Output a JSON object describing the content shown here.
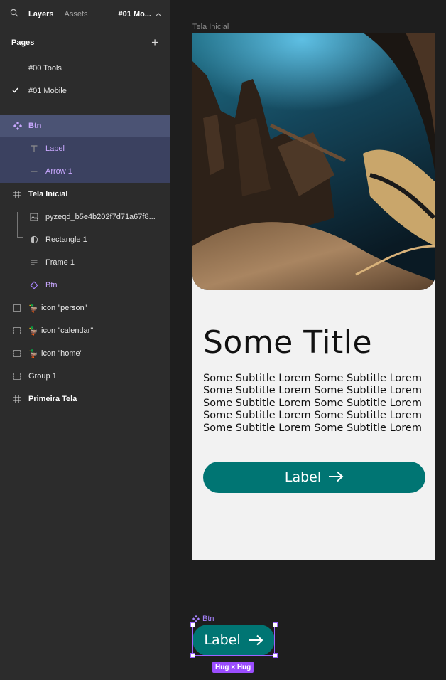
{
  "topbar": {
    "tabs": [
      "Layers",
      "Assets"
    ],
    "page_selector": "#01 Mo...",
    "icons": [
      "search-icon",
      "chevron-up-icon"
    ]
  },
  "pages": {
    "heading": "Pages",
    "items": [
      {
        "label": "#00 Tools",
        "current": false
      },
      {
        "label": "#01 Mobile",
        "current": true
      }
    ]
  },
  "layers": [
    {
      "label": "Btn",
      "icon": "component-icon"
    },
    {
      "label": "Label",
      "icon": "text-icon"
    },
    {
      "label": "Arrow 1",
      "icon": "line-icon"
    },
    {
      "label": "Tela Inicial",
      "icon": "frame-icon"
    },
    {
      "label": "pyzeqd_b5e4b202f7d71a67f8...",
      "icon": "image-icon"
    },
    {
      "label": "Rectangle 1",
      "icon": "rectangle-icon"
    },
    {
      "label": "Frame 1",
      "icon": "autolayout-icon"
    },
    {
      "label": "Btn",
      "icon": "instance-icon"
    },
    {
      "label": "icon \"person\"",
      "icon": "group-icon"
    },
    {
      "label": "icon \"calendar\"",
      "icon": "group-icon"
    },
    {
      "label": "icon \"home\"",
      "icon": "group-icon"
    },
    {
      "label": "Group 1",
      "icon": "group-icon"
    },
    {
      "label": "Primeira Tela",
      "icon": "frame-icon"
    }
  ],
  "canvas": {
    "frame_label": "Tela Inicial",
    "title": "Some Title",
    "subtitle": "Some Subtitle Lorem Some Subtitle Lorem Some Subtitle Lorem Some Subtitle Lorem Some Subtitle Lorem Some Subtitle Lorem Some Subtitle Lorem Some Subtitle Lorem Some Subtitle Lorem Some Subtitle Lorem",
    "button_label": "Label",
    "component_label": "Btn",
    "component_button_label": "Label",
    "sizing_badge": "Hug × Hug"
  },
  "colors": {
    "accent": "#007573",
    "selection": "#9b63ff",
    "component_text": "#c9a8ff"
  }
}
